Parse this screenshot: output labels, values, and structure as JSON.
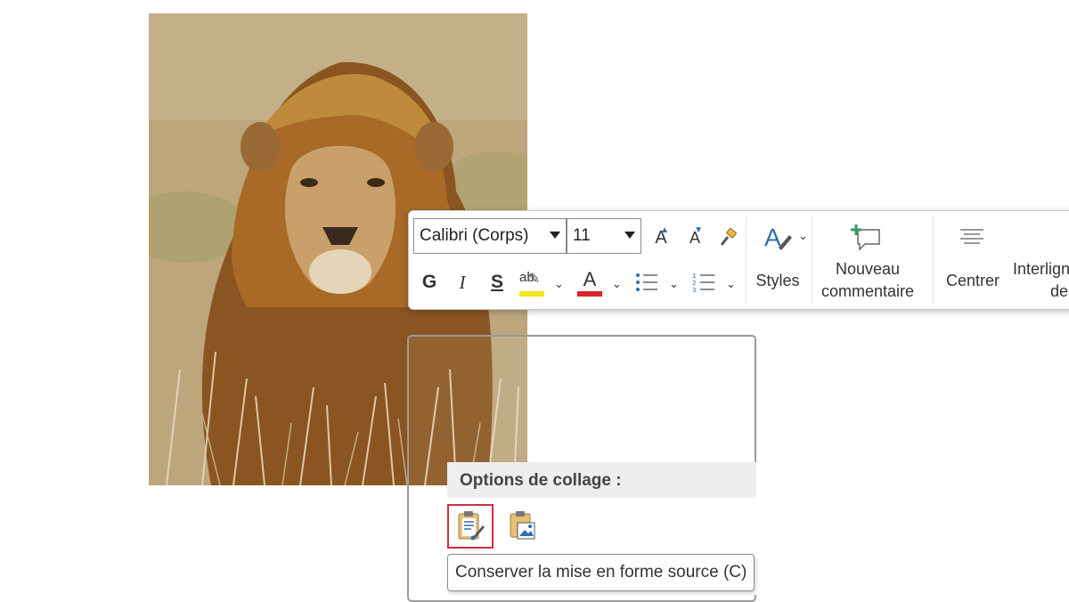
{
  "toolbar": {
    "font_name": "Calibri (Corps)",
    "font_size": "11",
    "grow_font_label": "A",
    "shrink_font_label": "A",
    "bold_label": "G",
    "italic_label": "I",
    "underline_label": "S",
    "highlight_label": "ab",
    "font_color_label": "A",
    "styles_label": "Styles",
    "new_comment_line1": "Nouveau",
    "new_comment_line2": "commentaire",
    "center_label": "Centrer",
    "line_spacing_line1": "Interligne",
    "line_spacing_line2": "de"
  },
  "paste_menu": {
    "header": "Options de collage :",
    "options": [
      {
        "icon": "keep-source-formatting-icon",
        "selected": true
      },
      {
        "icon": "picture-paste-icon",
        "selected": false
      }
    ],
    "tooltip": "Conserver la mise en forme source (C)"
  },
  "colors": {
    "highlight": "#f5e71b",
    "font_color": "#d9262a",
    "selection_border": "#d0313a",
    "accent_blue": "#2f6db4"
  }
}
